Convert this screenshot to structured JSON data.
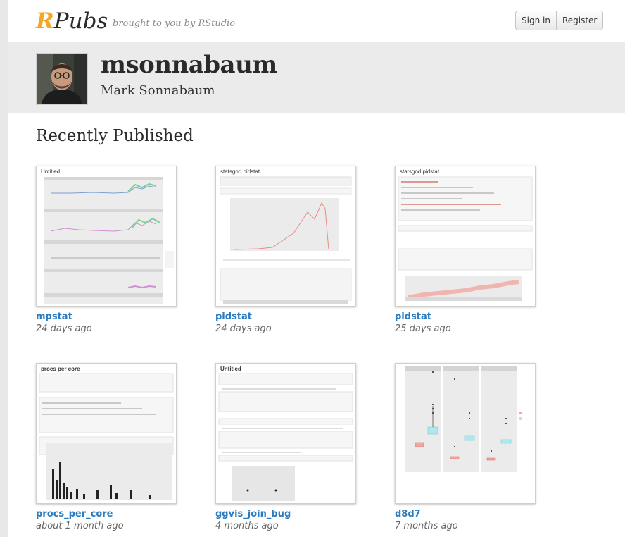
{
  "header": {
    "logo_r": "R",
    "logo_rest": "Pubs",
    "tagline": "brought to you by RStudio",
    "sign_in": "Sign in",
    "register": "Register"
  },
  "profile": {
    "username": "msonnabaum",
    "full_name": "Mark Sonnabaum"
  },
  "section_title": "Recently Published",
  "cards": [
    {
      "thumb_title": "Untitled",
      "title": "mpstat",
      "date": "24 days ago"
    },
    {
      "thumb_title": "statsgod pidstat",
      "title": "pidstat",
      "date": "24 days ago"
    },
    {
      "thumb_title": "statsgod pidstat",
      "title": "pidstat",
      "date": "25 days ago"
    },
    {
      "thumb_title": "procs per core",
      "title": "procs_per_core",
      "date": "about 1 month ago"
    },
    {
      "thumb_title": "Untitled",
      "title": "ggvis_join_bug",
      "date": "4 months ago"
    },
    {
      "thumb_title": "",
      "title": "d8d7",
      "date": "7 months ago"
    }
  ]
}
